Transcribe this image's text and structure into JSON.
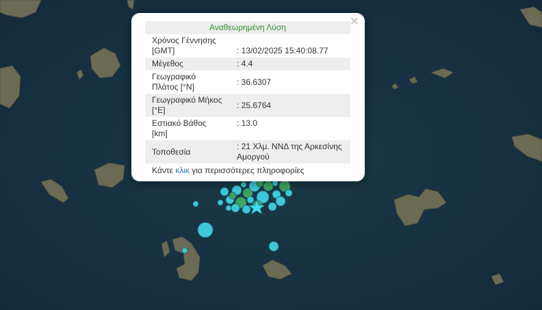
{
  "popup": {
    "title": "Αναθεωρημένη Λύση",
    "close_symbol": "×",
    "rows": [
      {
        "label": "Χρόνος Γέννησης [GMT]",
        "value": ": 13/02/2025 15:40:08.77"
      },
      {
        "label": "Μέγεθος",
        "value": ": 4.4"
      },
      {
        "label": "Γεωγραφικό Πλάτος [°N]",
        "value": ": 36.6307"
      },
      {
        "label": "Γεωγραφικό Μήκος [°E]",
        "value": ": 25.6764"
      },
      {
        "label": "Εστιακό Βάθος [km]",
        "value": ": 13.0"
      },
      {
        "label": "Τοποθεσία",
        "value": ": 21 Χλμ. ΝΝΔ της Αρκεσίνης Αμοργού"
      }
    ],
    "more_prefix": "Κάντε ",
    "more_link": "κλικ",
    "more_suffix": " για περισσότερες πληροφορίες"
  },
  "map": {
    "sea_color": "#16323f",
    "land_color": "#6b6a55",
    "marker_colors": {
      "shallow": "#3fc8d8",
      "deep": "#3fa55a"
    },
    "epicenter_icon": "star-icon",
    "epicenter_color": "#3fe0ef"
  }
}
